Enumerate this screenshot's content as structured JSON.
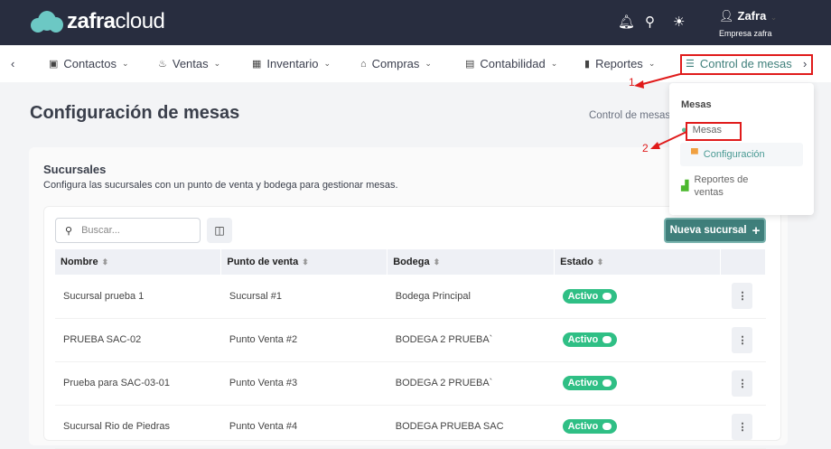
{
  "header": {
    "logo_bold": "zafra",
    "logo_light": "cloud",
    "user_name": "Zafra",
    "company": "Empresa zafra",
    "icons": [
      "bell-icon",
      "search-icon",
      "sun-icon",
      "user-icon"
    ]
  },
  "nav": {
    "items": [
      {
        "label": "Contactos"
      },
      {
        "label": "Ventas"
      },
      {
        "label": "Inventario"
      },
      {
        "label": "Compras"
      },
      {
        "label": "Contabilidad"
      },
      {
        "label": "Reportes"
      },
      {
        "label": "Control de mesas"
      }
    ]
  },
  "page": {
    "title": "Configuración de mesas",
    "breadcrumb": "Control de mesas"
  },
  "card": {
    "title": "Sucursales",
    "description": "Configura las sucursales con un punto de venta y bodega para gestionar mesas."
  },
  "toolbar": {
    "search_placeholder": "Buscar...",
    "new_button": "Nueva sucursal"
  },
  "table": {
    "headers": [
      "Nombre",
      "Punto de venta",
      "Bodega",
      "Estado"
    ],
    "rows": [
      {
        "nombre": "Sucursal prueba 1",
        "punto": "Sucursal #1",
        "bodega": "Bodega Principal",
        "estado": "Activo"
      },
      {
        "nombre": "PRUEBA SAC-02",
        "punto": "Punto Venta #2",
        "bodega": "BODEGA 2 PRUEBA`",
        "estado": "Activo"
      },
      {
        "nombre": "Prueba para SAC-03-01",
        "punto": "Punto Venta #3",
        "bodega": "BODEGA 2 PRUEBA`",
        "estado": "Activo"
      },
      {
        "nombre": "Sucursal Rio de Piedras",
        "punto": "Punto Venta #4",
        "bodega": "BODEGA PRUEBA SAC",
        "estado": "Activo"
      }
    ]
  },
  "dropdown": {
    "heading": "Mesas",
    "items": [
      {
        "label": "Mesas"
      },
      {
        "label": "Configuración"
      },
      {
        "label": "Reportes de ventas"
      }
    ]
  },
  "annotations": {
    "step1": "1",
    "step2": "2"
  },
  "colors": {
    "header": "#282d3f",
    "primary": "#3f7f7b",
    "active": "#2fbf85",
    "annotation": "#e01b1b"
  }
}
